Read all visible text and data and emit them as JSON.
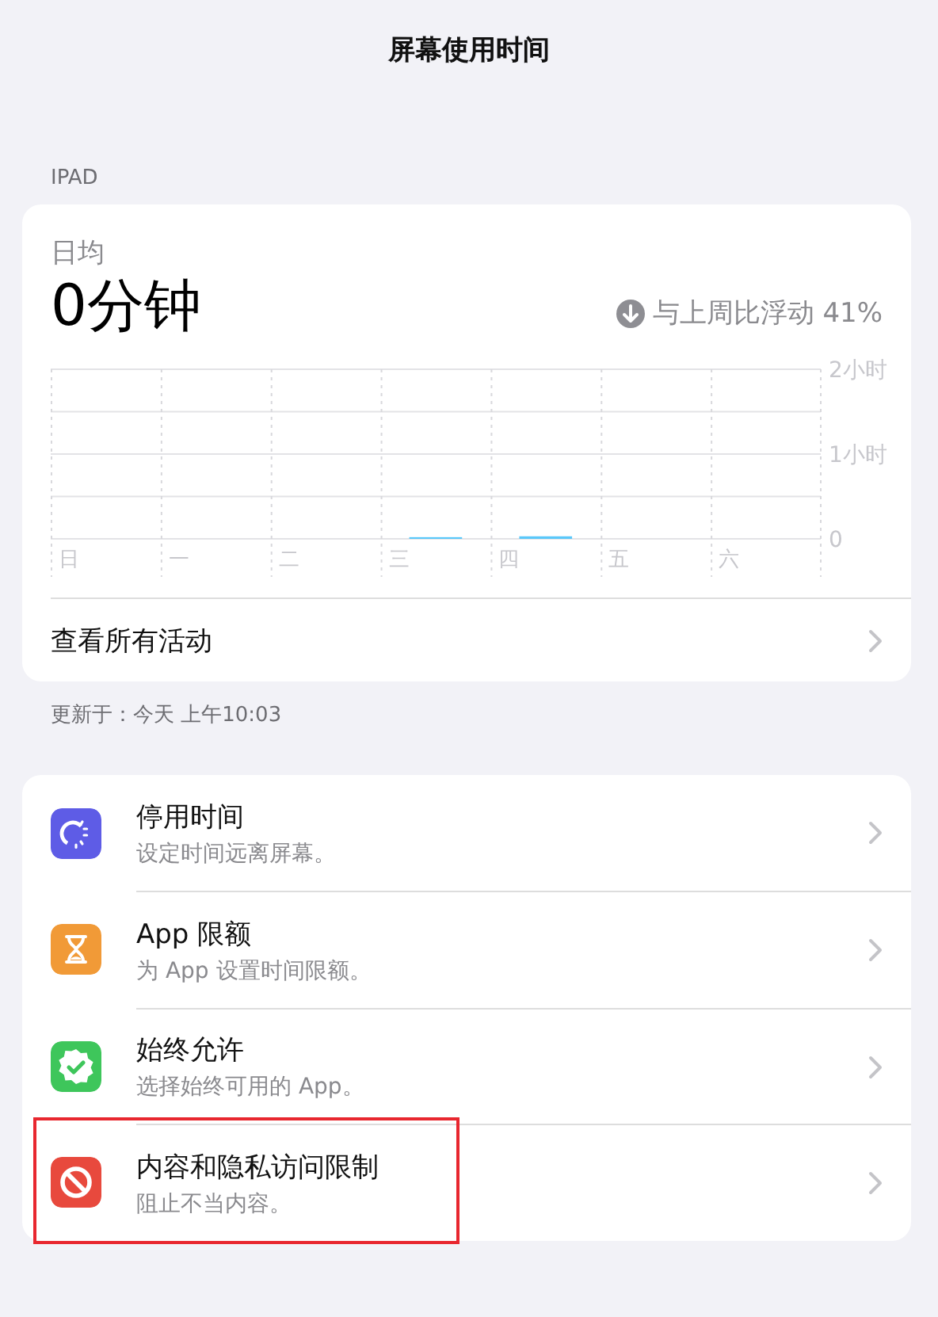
{
  "window": {
    "title": "屏幕使用时间"
  },
  "section_label": "IPAD",
  "summary": {
    "label": "日均",
    "value": "0分钟",
    "trend": "与上周比浮动 41%",
    "chart_data": {
      "type": "bar",
      "categories": [
        "日",
        "一",
        "二",
        "三",
        "四",
        "五",
        "六"
      ],
      "values": [
        0,
        0,
        0,
        0.02,
        0.03,
        0,
        0
      ],
      "ylim": [
        0,
        2
      ],
      "yticks": [
        {
          "value": 0,
          "label": "0"
        },
        {
          "value": 1,
          "label": "1小时"
        },
        {
          "value": 2,
          "label": "2小时"
        }
      ]
    },
    "link": "查看所有活动"
  },
  "updated": "更新于：今天 上午10:03",
  "items": [
    {
      "kind": "downtime",
      "color": "#5e5ce6",
      "title": "停用时间",
      "subtitle": "设定时间远离屏幕。",
      "highlighted": false
    },
    {
      "kind": "app_limits",
      "color": "#f19a37",
      "title": "App 限额",
      "subtitle": "为 App 设置时间限额。",
      "highlighted": false
    },
    {
      "kind": "always_allowed",
      "color": "#3ec65b",
      "title": "始终允许",
      "subtitle": "选择始终可用的 App。",
      "highlighted": false
    },
    {
      "kind": "restrictions",
      "color": "#e8493d",
      "title": "内容和隐私访问限制",
      "subtitle": "阻止不当内容。",
      "highlighted": true
    }
  ]
}
